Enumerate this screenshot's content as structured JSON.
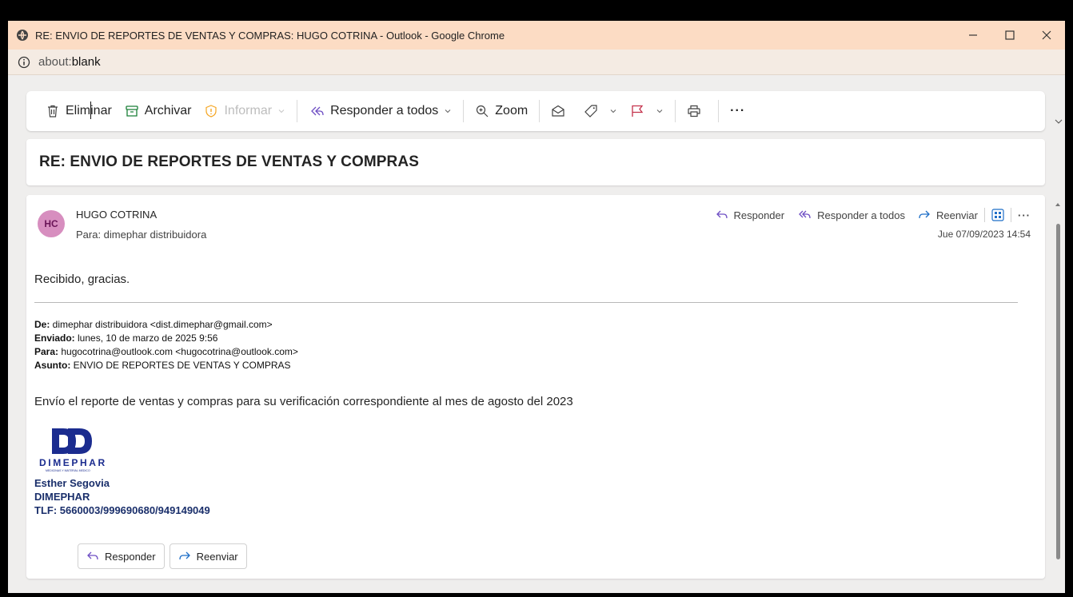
{
  "browser": {
    "window_title": "RE: ENVIO DE REPORTES DE VENTAS Y COMPRAS: HUGO COTRINA - Outlook - Google Chrome",
    "url_prefix": "about:",
    "url_main": "blank"
  },
  "toolbar": {
    "delete_label": "Eliminar",
    "archive_label": "Archivar",
    "report_label": "Informar",
    "reply_all_label": "Responder a todos",
    "zoom_label": "Zoom",
    "more_label": "···"
  },
  "subject": "RE: ENVIO DE REPORTES DE VENTAS Y COMPRAS",
  "message": {
    "avatar_initials": "HC",
    "sender": "HUGO COTRINA",
    "to_line": "Para:  dimephar distribuidora",
    "date": "Jue 07/09/2023 14:54",
    "actions": {
      "reply": "Responder",
      "reply_all": "Responder a todos",
      "forward": "Reenviar",
      "more": "···"
    },
    "body": "Recibido, gracias.",
    "forwarded": {
      "from_label": "De:",
      "from_value": " dimephar distribuidora <dist.dimephar@gmail.com>",
      "sent_label": "Enviado:",
      "sent_value": " lunes, 10 de marzo de 2025 9:56",
      "to_label": "Para:",
      "to_value": " hugocotrina@outlook.com <hugocotrina@outlook.com>",
      "subject_label": "Asunto:",
      "subject_value": " ENVIO DE REPORTES DE VENTAS Y COMPRAS",
      "text": "Envío el reporte de ventas y compras para su verificación correspondiente al mes de agosto del 2023"
    },
    "logo_text": "DIMEPHAR",
    "logo_subtext": "MEDICINAS Y MATERIAL MEDICO",
    "signature": {
      "name": "Esther Segovia",
      "company": "DIMEPHAR",
      "phone": "TLF: 5660003/999690680/949149049"
    },
    "bottom_reply": "Responder",
    "bottom_forward": "Reenviar"
  },
  "colors": {
    "titlebar": "#fcdcc4",
    "avatar_bg": "#d78ebf",
    "reply_icon": "#6f4fc4",
    "forward_icon": "#1f6fc8",
    "archive_icon": "#1a7f37",
    "flag_icon": "#c4314b",
    "logo_blue": "#1b2c8f"
  }
}
